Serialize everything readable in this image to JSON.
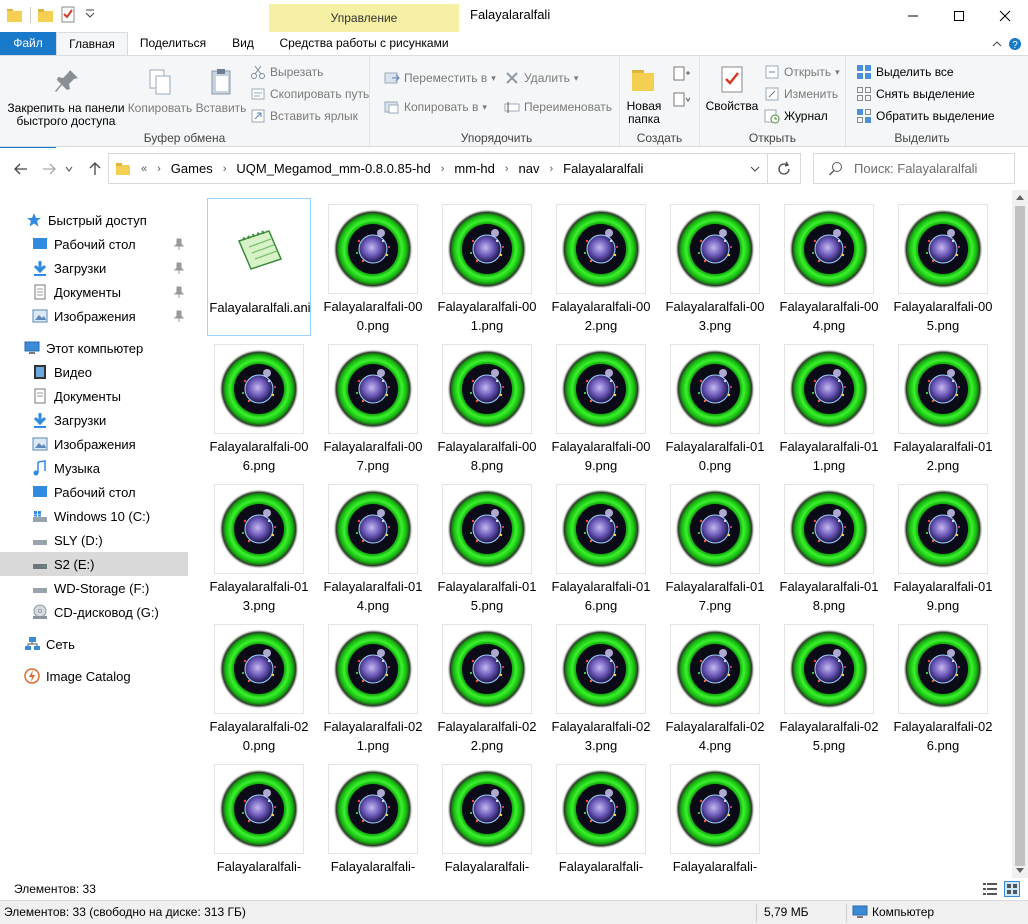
{
  "window": {
    "manage_tab": "Управление",
    "title": "Falayalaralfali"
  },
  "tabs": {
    "file": "Файл",
    "home": "Главная",
    "share": "Поделиться",
    "view": "Вид",
    "picture_tools": "Средства работы с рисунками"
  },
  "ribbon": {
    "clipboard": {
      "pin": "Закрепить на панели быстрого доступа",
      "copy": "Копировать",
      "paste": "Вставить",
      "cut": "Вырезать",
      "copy_path": "Скопировать путь",
      "paste_shortcut": "Вставить ярлык",
      "label": "Буфер обмена"
    },
    "organize": {
      "move_to": "Переместить в",
      "copy_to": "Копировать в",
      "delete": "Удалить",
      "rename": "Переименовать",
      "label": "Упорядочить"
    },
    "new": {
      "new_folder": "Новая папка",
      "label": "Создать"
    },
    "open": {
      "properties": "Свойства",
      "open": "Открыть",
      "edit": "Изменить",
      "history": "Журнал",
      "label": "Открыть"
    },
    "select": {
      "select_all": "Выделить все",
      "select_none": "Снять выделение",
      "invert": "Обратить выделение",
      "label": "Выделить"
    }
  },
  "address": {
    "overflow": "«",
    "crumbs": [
      "Games",
      "UQM_Megamod_mm-0.8.0.85-hd",
      "mm-hd",
      "nav",
      "Falayalaralfali"
    ],
    "search_placeholder": "Поиск: Falayalaralfali"
  },
  "nav": {
    "quick_access": "Быстрый доступ",
    "qa_items": [
      "Рабочий стол",
      "Загрузки",
      "Документы",
      "Изображения"
    ],
    "this_pc": "Этот компьютер",
    "pc_items": [
      "Видео",
      "Документы",
      "Загрузки",
      "Изображения",
      "Музыка",
      "Рабочий стол",
      "Windows 10 (C:)",
      "SLY (D:)",
      "S2 (E:)",
      "WD-Storage (F:)",
      "CD-дисковод (G:)"
    ],
    "network": "Сеть",
    "image_catalog": "Image Catalog"
  },
  "files": [
    "Falayalaralfali.ani",
    "Falayalaralfali-000.png",
    "Falayalaralfali-001.png",
    "Falayalaralfali-002.png",
    "Falayalaralfali-003.png",
    "Falayalaralfali-004.png",
    "Falayalaralfali-005.png",
    "Falayalaralfali-006.png",
    "Falayalaralfali-007.png",
    "Falayalaralfali-008.png",
    "Falayalaralfali-009.png",
    "Falayalaralfali-010.png",
    "Falayalaralfali-011.png",
    "Falayalaralfali-012.png",
    "Falayalaralfali-013.png",
    "Falayalaralfali-014.png",
    "Falayalaralfali-015.png",
    "Falayalaralfali-016.png",
    "Falayalaralfali-017.png",
    "Falayalaralfali-018.png",
    "Falayalaralfali-019.png",
    "Falayalaralfali-020.png",
    "Falayalaralfali-021.png",
    "Falayalaralfali-022.png",
    "Falayalaralfali-023.png",
    "Falayalaralfali-024.png",
    "Falayalaralfali-025.png",
    "Falayalaralfali-026.png",
    "Falayalaralfali-",
    "Falayalaralfali-",
    "Falayalaralfali-",
    "Falayalaralfali-",
    "Falayalaralfali-"
  ],
  "status": {
    "items_top": "Элементов: 33",
    "items_bottom": "Элементов: 33 (свободно на диске: 313 ГБ)",
    "size": "5,79 МБ",
    "computer": "Компьютер"
  },
  "colors": {
    "file_tab": "#1979ca",
    "manage_tab": "#f6f0a4",
    "selection": "#d9d9d9",
    "thumb_green": "#22e01a"
  }
}
